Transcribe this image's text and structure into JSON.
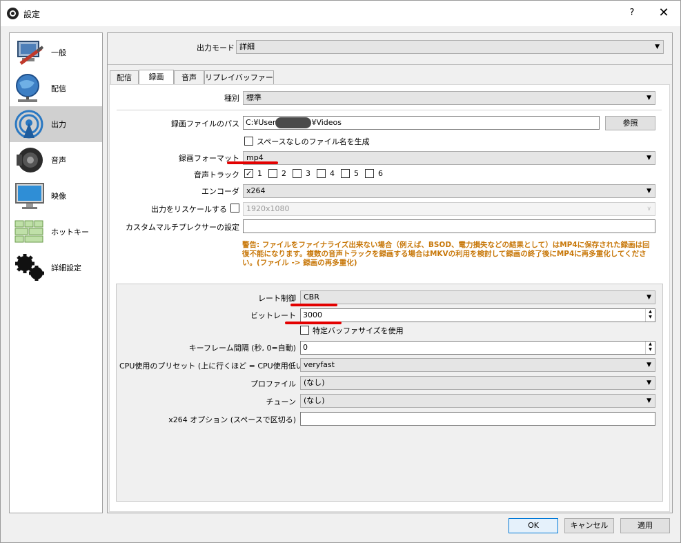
{
  "window": {
    "title": "設定",
    "help": "?",
    "close": "✕"
  },
  "sidebar": {
    "items": [
      {
        "label": "一般",
        "icon": "general-icon"
      },
      {
        "label": "配信",
        "icon": "stream-icon"
      },
      {
        "label": "出力",
        "icon": "output-icon"
      },
      {
        "label": "音声",
        "icon": "audio-icon"
      },
      {
        "label": "映像",
        "icon": "video-icon"
      },
      {
        "label": "ホットキー",
        "icon": "hotkeys-icon"
      },
      {
        "label": "詳細設定",
        "icon": "advanced-icon"
      }
    ],
    "selected_index": 2
  },
  "output_mode": {
    "label": "出力モード",
    "value": "詳細"
  },
  "tabs": [
    "配信",
    "録画",
    "音声",
    "リプレイバッファー"
  ],
  "active_tab": 1,
  "recording": {
    "type_label": "種別",
    "type_value": "標準",
    "path_label": "録画ファイルのパス",
    "path_value": "C:¥User",
    "path_value_end": "¥Videos",
    "browse_label": "参照",
    "nospace_label": "スペースなしのファイル名を生成",
    "format_label": "録画フォーマット",
    "format_value": "mp4",
    "tracks_label": "音声トラック",
    "tracks": [
      "1",
      "2",
      "3",
      "4",
      "5",
      "6"
    ],
    "tracks_checked": [
      true,
      false,
      false,
      false,
      false,
      false
    ],
    "encoder_label": "エンコーダ",
    "encoder_value": "x264",
    "rescale_label": "出力をリスケールする",
    "rescale_value": "1920x1080",
    "muxer_label": "カスタムマルチプレクサーの設定",
    "muxer_value": "",
    "warning": "警告: ファイルをファイナライズ出来ない場合（例えば、BSOD、電力損失などの結果として）はMP4に保存された録画は回復不能になります。複数の音声トラックを録画する場合はMKVの利用を検討して録画の終了後にMP4に再多重化してください。(ファイル -> 録画の再多重化)"
  },
  "encoder_settings": {
    "rate_control_label": "レート制御",
    "rate_control_value": "CBR",
    "bitrate_label": "ビットレート",
    "bitrate_value": "3000",
    "buffer_label": "特定バッファサイズを使用",
    "keyframe_label": "キーフレーム間隔 (秒, 0=自動)",
    "keyframe_value": "0",
    "preset_label": "CPU使用のプリセット (上に行くほど = CPU使用低い)",
    "preset_value": "veryfast",
    "profile_label": "プロファイル",
    "profile_value": "(なし)",
    "tune_label": "チューン",
    "tune_value": "(なし)",
    "x264opts_label": "x264 オプション (スペースで区切る)",
    "x264opts_value": ""
  },
  "buttons": {
    "ok": "OK",
    "cancel": "キャンセル",
    "apply": "適用"
  },
  "colors": {
    "warning": "#c8780a",
    "annotation": "#e30000",
    "selected": "#d0d0d0"
  }
}
